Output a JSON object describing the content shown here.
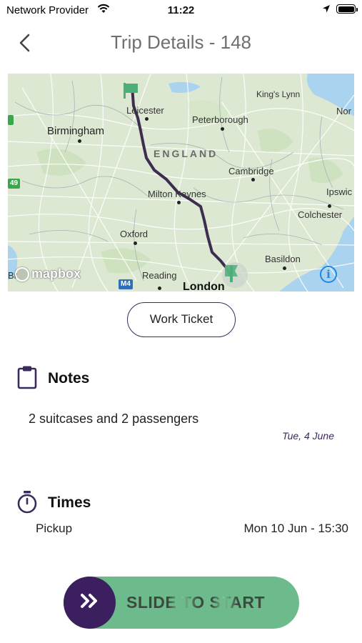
{
  "status_bar": {
    "carrier": "Network Provider",
    "time": "11:22"
  },
  "header": {
    "title": "Trip Details - 148"
  },
  "map": {
    "labels": {
      "leicester": "Leicester",
      "kings_lynn": "King's Lynn",
      "norwich": "Nor",
      "peterborough": "Peterborough",
      "birmingham": "Birmingham",
      "england": "ENGLAND",
      "cambridge": "Cambridge",
      "milton_keynes": "Milton Keynes",
      "ipswich": "Ipswic",
      "colchester": "Colchester",
      "oxford": "Oxford",
      "basildon": "Basildon",
      "reading": "Reading",
      "london": "London",
      "bristol": "Br",
      "m4": "M4",
      "a49": "49",
      "attribution": "mapbox"
    },
    "route_color": "#3d2e4f"
  },
  "work_ticket": {
    "label": "Work Ticket"
  },
  "notes": {
    "title": "Notes",
    "text": "2 suitcases and 2 passengers",
    "date": "Tue, 4 June"
  },
  "times": {
    "title": "Times",
    "pickup_label": "Pickup",
    "pickup_value": "Mon 10 Jun - 15:30"
  },
  "slider": {
    "label": "SLIDE TO START",
    "track_color": "#6dbb8c",
    "knob_color": "#3b1f5e"
  },
  "accent_color": "#3b2a5c"
}
